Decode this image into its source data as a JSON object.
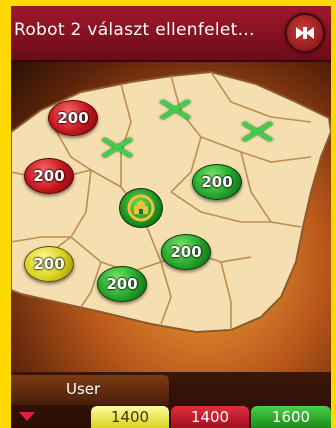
{
  "header": {
    "title": "Robot 2 választ ellenfelet...",
    "button_icon": "close-icon"
  },
  "map": {
    "territories": [
      {
        "id": "t1",
        "status": "red",
        "value": "200"
      },
      {
        "id": "t2",
        "status": "red",
        "value": "200"
      },
      {
        "id": "t3",
        "status": "green",
        "value": "200"
      },
      {
        "id": "t4",
        "status": "yellow",
        "value": "200"
      },
      {
        "id": "t5",
        "status": "green",
        "value": "200"
      },
      {
        "id": "t6",
        "status": "green",
        "value": "200"
      }
    ],
    "center_icon": "castle-icon"
  },
  "players": {
    "active_tab": "User",
    "scores": [
      {
        "color": "#d8d21c",
        "value": "1400"
      },
      {
        "color": "#c0141c",
        "value": "1400"
      },
      {
        "color": "#22a22a",
        "value": "1600"
      }
    ]
  },
  "colors": {
    "frame": "#ffd800",
    "header": "#a0182a"
  }
}
